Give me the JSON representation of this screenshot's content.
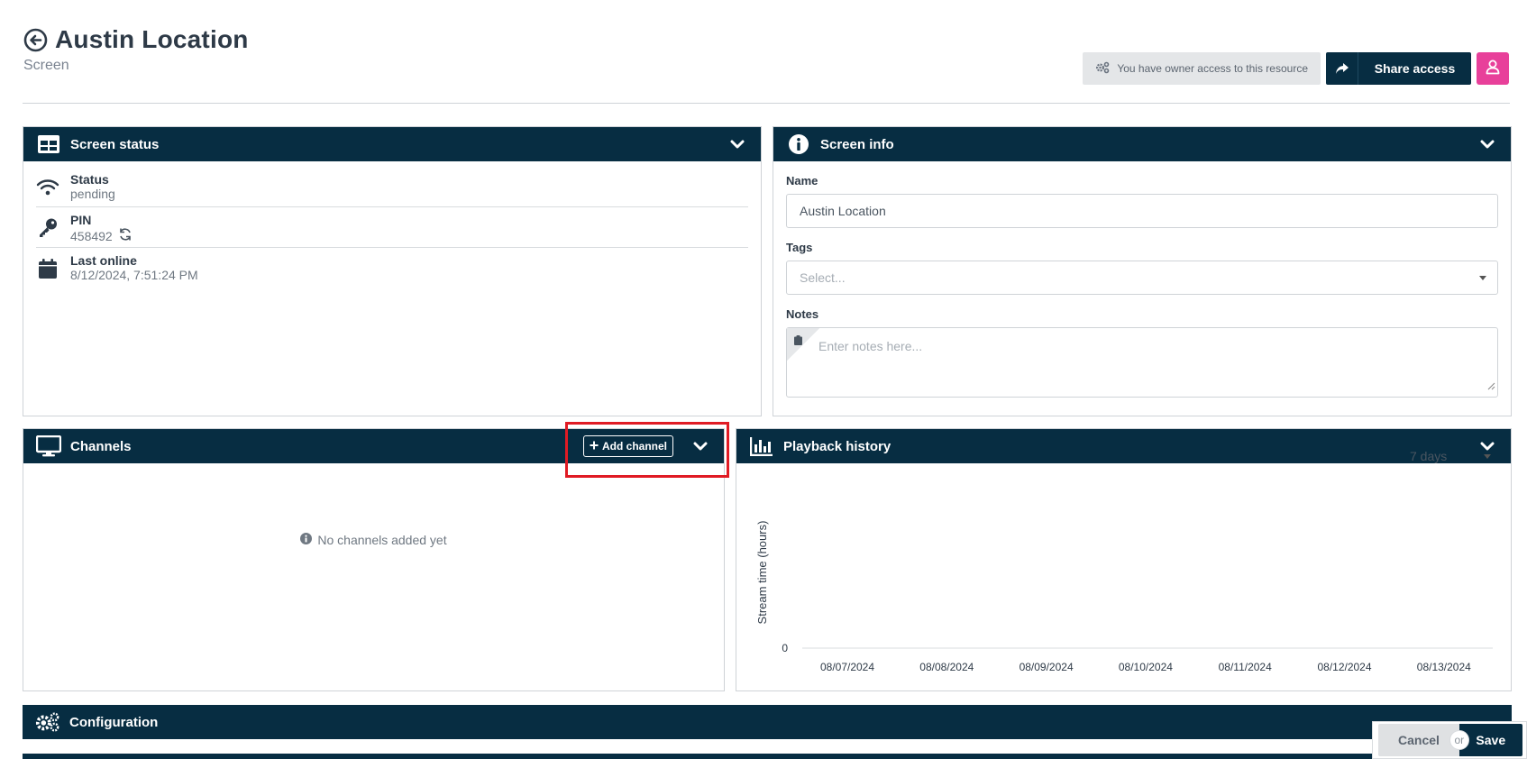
{
  "header": {
    "title": "Austin Location",
    "subtitle": "Screen",
    "owner_notice": "You have owner access to this resource",
    "share_label": "Share access"
  },
  "screen_status": {
    "title": "Screen status",
    "rows": [
      {
        "label": "Status",
        "value": "pending",
        "icon": "wifi-icon"
      },
      {
        "label": "PIN",
        "value": "458492",
        "icon": "key-icon"
      },
      {
        "label": "Last online",
        "value": "8/12/2024, 7:51:24 PM",
        "icon": "calendar-icon"
      }
    ]
  },
  "screen_info": {
    "title": "Screen info",
    "name_label": "Name",
    "name_value": "Austin Location",
    "tags_label": "Tags",
    "tags_placeholder": "Select...",
    "notes_label": "Notes",
    "notes_placeholder": "Enter notes here..."
  },
  "channels": {
    "title": "Channels",
    "add_label": "Add channel",
    "empty_message": "No channels added yet"
  },
  "playback": {
    "title": "Playback history",
    "range": "7 days",
    "y_label": "Stream time (hours)",
    "y_tick": "0",
    "dates": [
      "08/07/2024",
      "08/08/2024",
      "08/09/2024",
      "08/10/2024",
      "08/11/2024",
      "08/12/2024",
      "08/13/2024"
    ]
  },
  "configuration": {
    "title": "Configuration"
  },
  "footer": {
    "cancel_label": "Cancel",
    "or_label": "or",
    "save_label": "Save"
  },
  "colors": {
    "panel_header": "#072d42",
    "accent_pink": "#e8409a",
    "highlight_red": "#e01b24"
  }
}
